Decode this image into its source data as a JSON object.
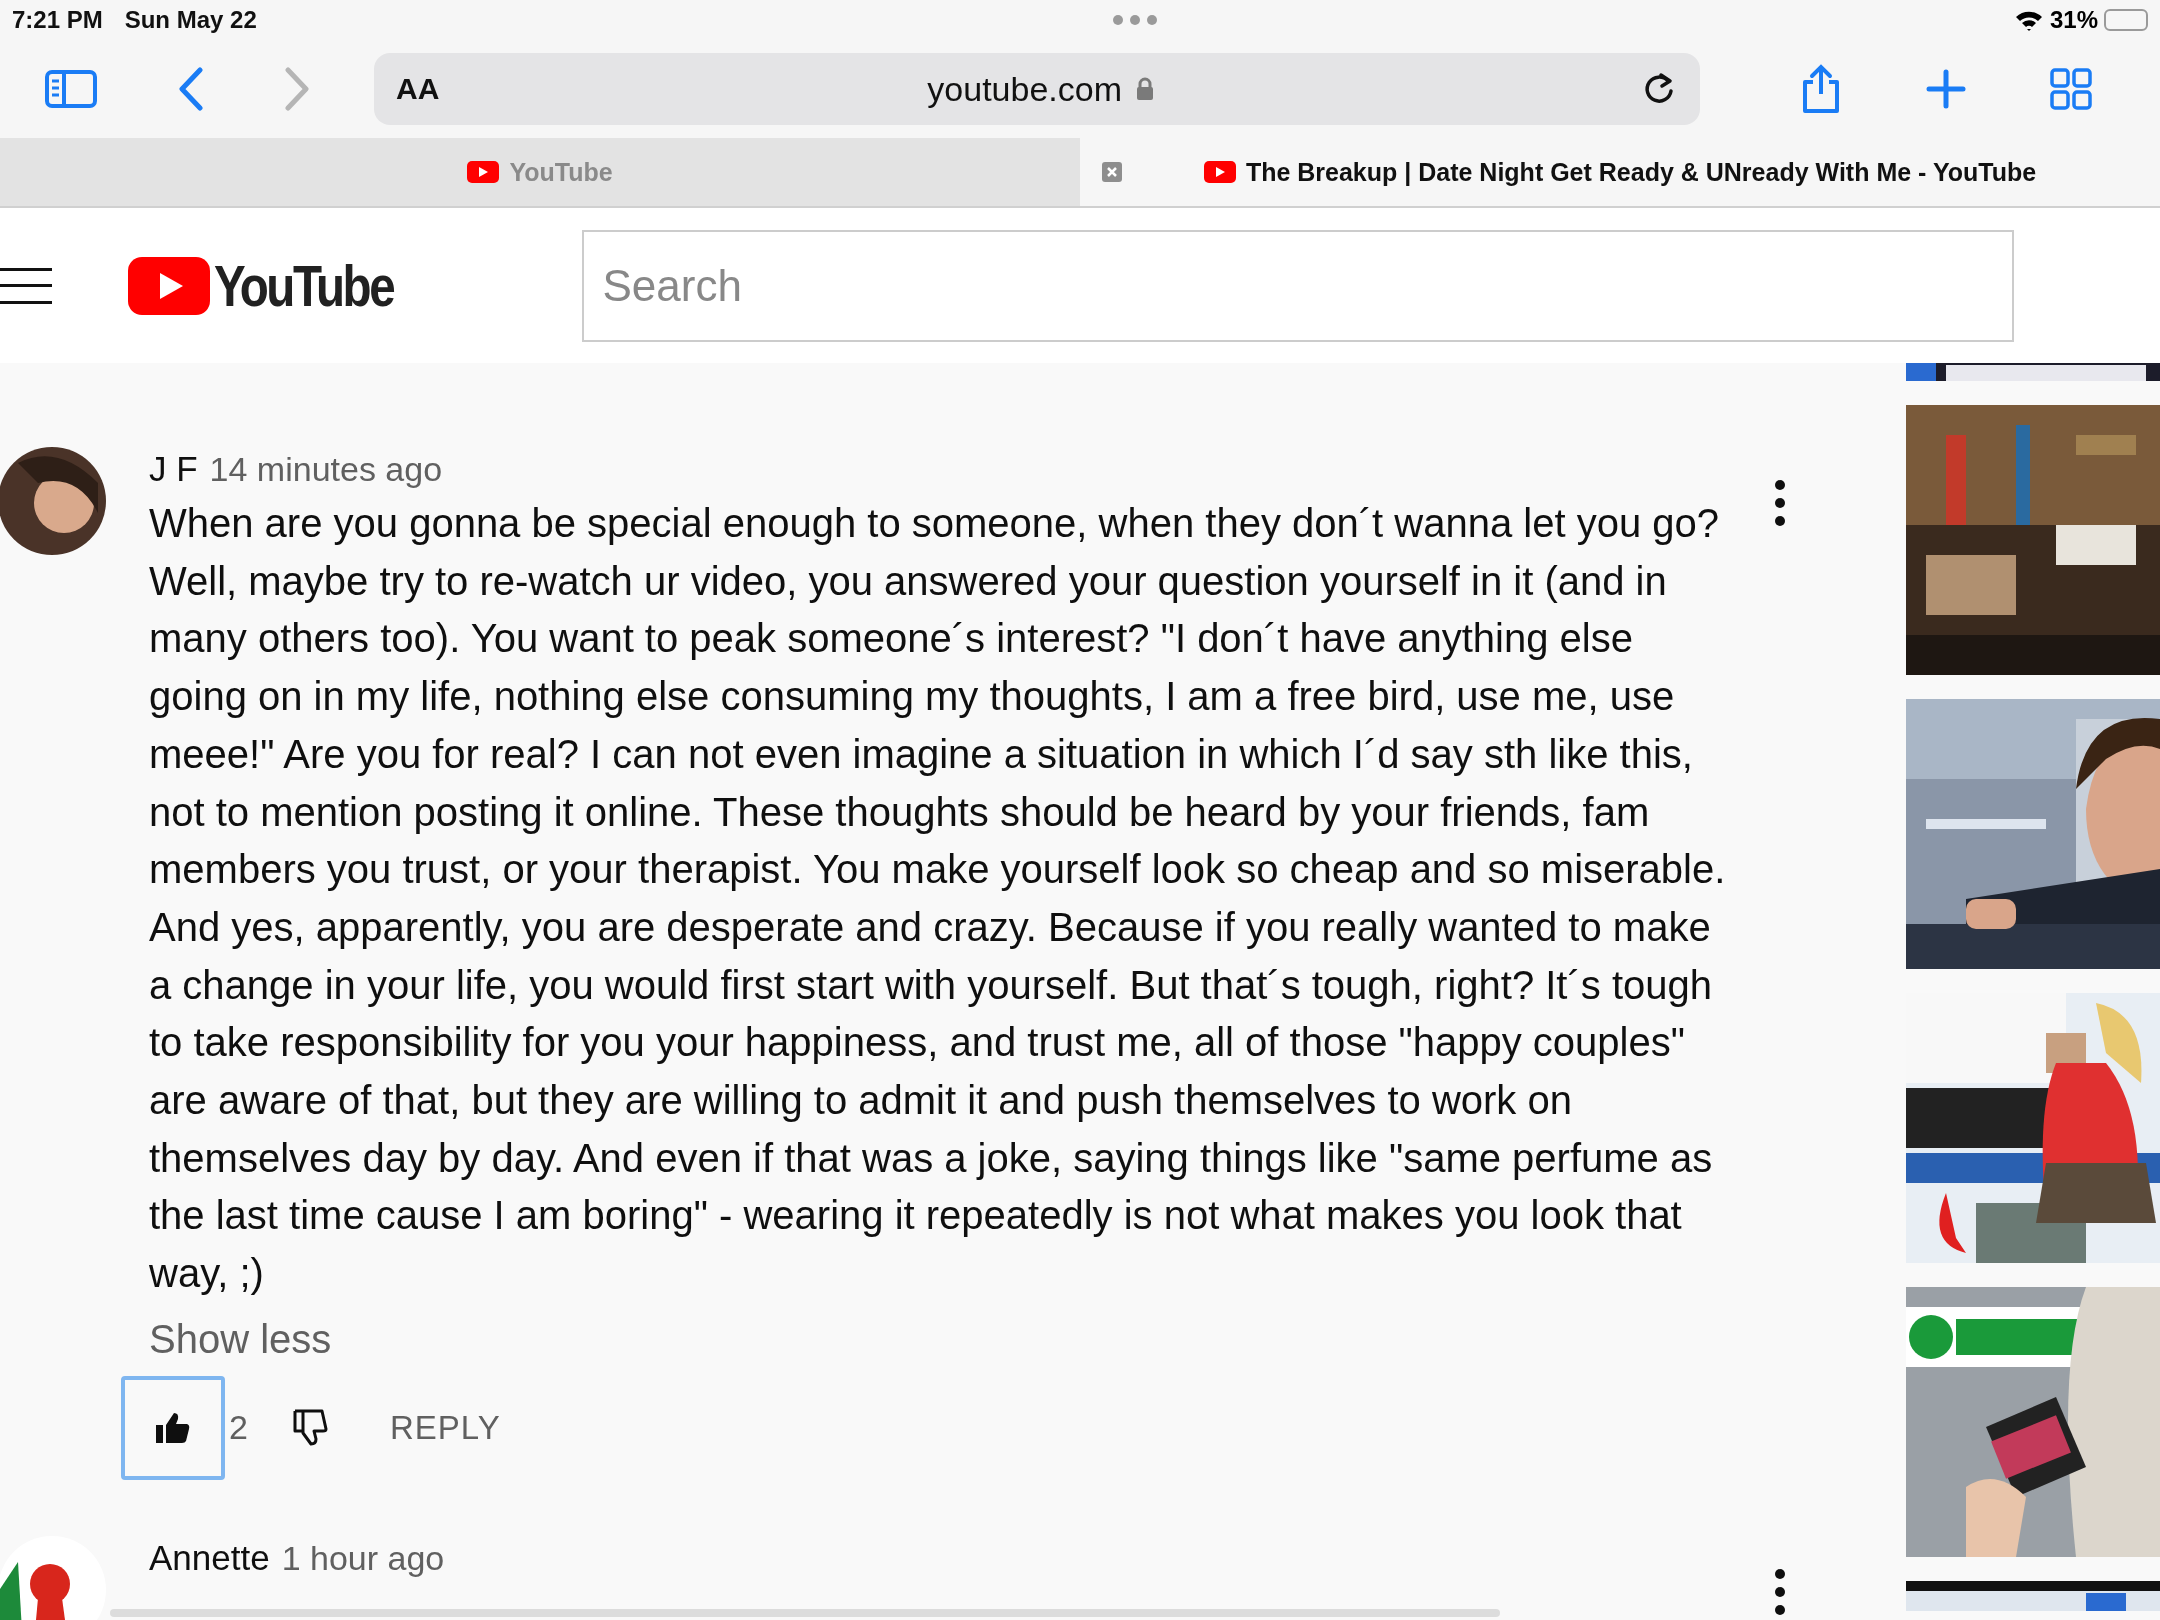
{
  "status_bar": {
    "time": "7:21 PM",
    "date": "Sun May 22",
    "battery": "31%"
  },
  "toolbar": {
    "text_size": "AA",
    "url": "youtube.com"
  },
  "tabs": [
    {
      "title": "YouTube",
      "selected": false
    },
    {
      "title": "The Breakup | Date Night Get Ready & UNready With Me - YouTube",
      "selected": true
    }
  ],
  "header": {
    "logo": "YouTube",
    "search": {
      "placeholder": "Search"
    }
  },
  "comments": [
    {
      "author": "J F",
      "time": "14 minutes ago",
      "text": "When are you gonna be special enough to someone, when they don´t wanna let you go? Well, maybe try to re-watch ur video, you answered your question yourself in it (and in many others too). You want to peak someone´s interest? \"I don´t have anything else going on in my life, nothing else consuming my thoughts, I am a free bird, use me, use meee!\" Are you for real? I can not even imagine a situation in which I´d say sth like this, not to mention posting it online. These thoughts should be heard by your friends, fam members you trust, or your therapist. You make yourself look so cheap and so miserable. And yes, apparently, you are desperate and crazy. Because if you really wanted to make a change in your life, you would first start with yourself. But that´s tough, right? It´s tough to take responsibility for you your happiness, and trust me, all of those \"happy couples\" are aware of that, but they are willing to admit it and push themselves to work on themselves day by day. And even if that was a joke, saying things like \"same perfume as the last time cause I am boring\" - wearing it repeatedly is not what makes you look that way, ;)",
      "toggle": "Show less",
      "likes": "2",
      "reply": "REPLY",
      "liked": false,
      "focused": true
    },
    {
      "author": "Annette",
      "time": "1 hour ago"
    }
  ]
}
